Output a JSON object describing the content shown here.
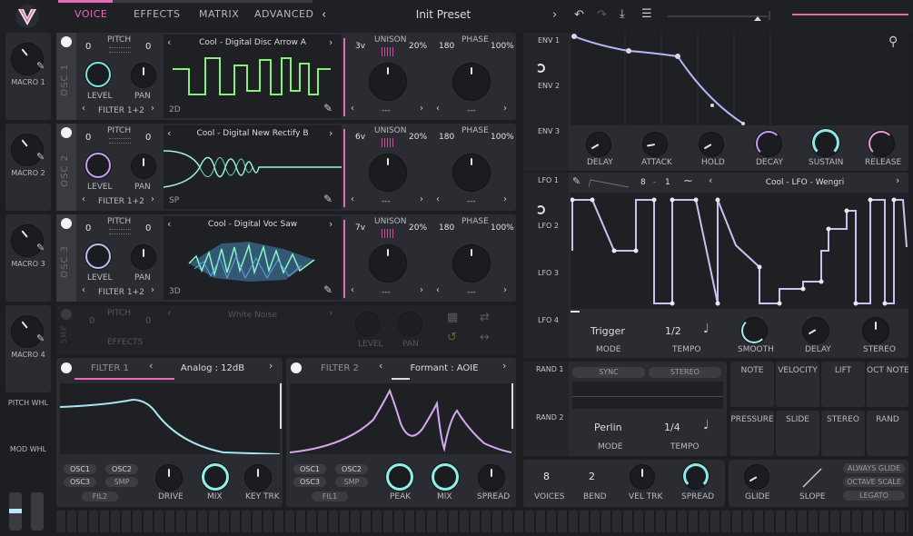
{
  "header": {
    "tabs": [
      "VOICE",
      "EFFECTS",
      "MATRIX",
      "ADVANCED"
    ],
    "preset_name": "Init Preset"
  },
  "macros": [
    "MACRO 1",
    "MACRO 2",
    "MACRO 3",
    "MACRO 4"
  ],
  "left_misc": {
    "pitch": "PITCH WHL",
    "mod": "MOD WHL"
  },
  "oscs": [
    {
      "id": "OSC 1",
      "pitch_l": "0",
      "pitch_r": "0",
      "wave": "Cool - Digital Disc Arrow A",
      "mode": "2D",
      "filter": "FILTER 1+2",
      "voices": "3v",
      "unison_pct": "20%",
      "phase_val": "180",
      "phase_pct": "100%",
      "dash1": "---",
      "dash2": "---"
    },
    {
      "id": "OSC 2",
      "pitch_l": "0",
      "pitch_r": "0",
      "wave": "Cool - Digital New Rectify B",
      "mode": "SP",
      "filter": "FILTER 1+2",
      "voices": "6v",
      "unison_pct": "20%",
      "phase_val": "180",
      "phase_pct": "100%",
      "dash1": "---",
      "dash2": "---"
    },
    {
      "id": "OSC 3",
      "pitch_l": "0",
      "pitch_r": "0",
      "wave": "Cool - Digital Voc Saw",
      "mode": "3D",
      "filter": "FILTER 1+2",
      "voices": "7v",
      "unison_pct": "20%",
      "phase_val": "180",
      "phase_pct": "100%",
      "dash1": "---",
      "dash2": "---"
    }
  ],
  "osc_labels": {
    "pitch": "PITCH",
    "level": "LEVEL",
    "pan": "PAN",
    "unison": "UNISON",
    "phase": "PHASE"
  },
  "smp": {
    "id": "SMP",
    "pitch_l": "0",
    "pitch_r": "0",
    "label": "PITCH",
    "wave": "White Noise",
    "effects": "EFFECTS",
    "level": "LEVEL",
    "pan": "PAN"
  },
  "filter1": {
    "title": "FILTER 1",
    "type": "Analog : 12dB",
    "b1": "OSC1",
    "b2": "OSC2",
    "b3": "OSC3",
    "b4": "SMP",
    "src": "FIL2",
    "k1": "DRIVE",
    "k2": "MIX",
    "k3": "KEY TRK"
  },
  "filter2": {
    "title": "FILTER 2",
    "type": "Formant : AOIE",
    "b1": "OSC1",
    "b2": "OSC2",
    "b3": "OSC3",
    "b4": "SMP",
    "src": "FIL1",
    "k1": "PEAK",
    "k2": "MIX",
    "k3": "SPREAD"
  },
  "env": {
    "tabs": [
      "ENV 1",
      "ENV 2",
      "ENV 3"
    ],
    "knobs": [
      "DELAY",
      "ATTACK",
      "HOLD",
      "DECAY",
      "SUSTAIN",
      "RELEASE"
    ]
  },
  "lfo": {
    "tabs": [
      "LFO 1",
      "LFO 2",
      "LFO 3",
      "LFO 4"
    ],
    "grid_x": "8",
    "grid_sep": "-",
    "grid_y": "1",
    "preset": "Cool - LFO - Wengri",
    "trigger": "Trigger",
    "rate": "1/2",
    "mode": "MODE",
    "tempo": "TEMPO",
    "smooth": "SMOOTH",
    "delay": "DELAY",
    "stereo": "STEREO"
  },
  "rand": {
    "tabs": [
      "RAND 1",
      "RAND 2"
    ],
    "sync": "SYNC",
    "stereo": "STEREO",
    "type": "Perlin",
    "rate": "1/4",
    "mode": "MODE",
    "tempo": "TEMPO"
  },
  "mod_sources": [
    "NOTE",
    "VELOCITY",
    "LIFT",
    "OCT NOTE",
    "PRESSURE",
    "SLIDE",
    "STEREO",
    "RAND"
  ],
  "voice": {
    "voices_val": "8",
    "bend_val": "2",
    "voices": "VOICES",
    "bend": "BEND",
    "veltrk": "VEL TRK",
    "spread": "SPREAD",
    "glide": "GLIDE",
    "slope": "SLOPE",
    "always_glide": "ALWAYS GLIDE",
    "octave_scale": "OCTAVE SCALE",
    "legato": "LEGATO"
  },
  "colors": {
    "accent": "#aef0a8",
    "pink": "#e66ab8",
    "cyan": "#8ef0e6",
    "bg": "#1d1e22",
    "panel": "#2b2c31"
  }
}
